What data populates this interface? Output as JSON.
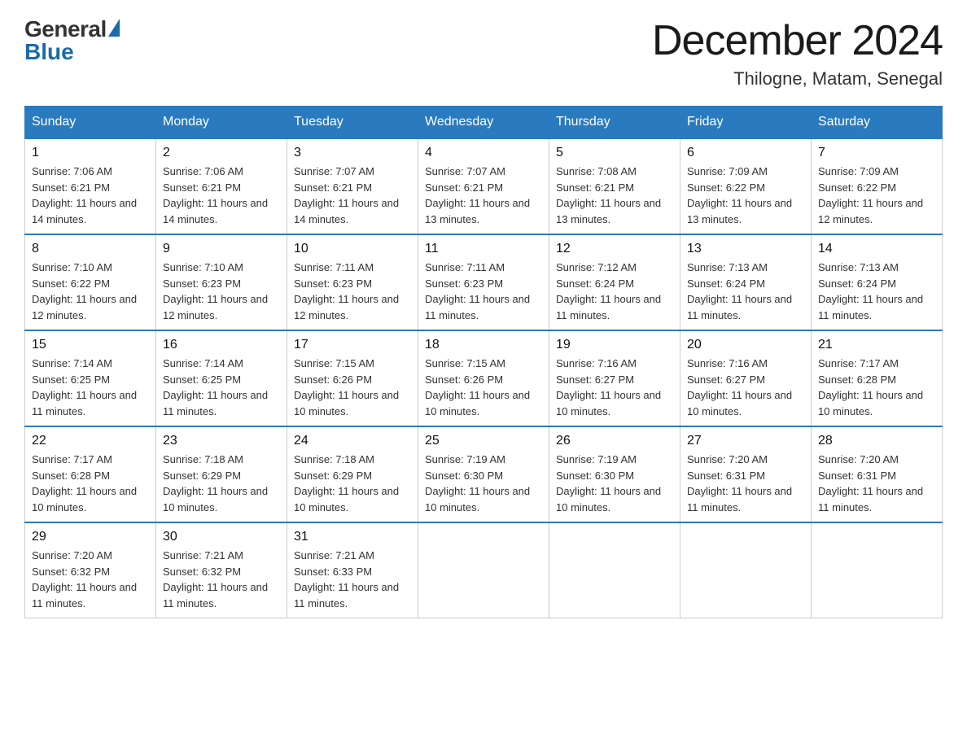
{
  "logo": {
    "general": "General",
    "blue": "Blue"
  },
  "title": "December 2024",
  "location": "Thilogne, Matam, Senegal",
  "days_of_week": [
    "Sunday",
    "Monday",
    "Tuesday",
    "Wednesday",
    "Thursday",
    "Friday",
    "Saturday"
  ],
  "weeks": [
    [
      {
        "day": "1",
        "sunrise": "7:06 AM",
        "sunset": "6:21 PM",
        "daylight": "11 hours and 14 minutes."
      },
      {
        "day": "2",
        "sunrise": "7:06 AM",
        "sunset": "6:21 PM",
        "daylight": "11 hours and 14 minutes."
      },
      {
        "day": "3",
        "sunrise": "7:07 AM",
        "sunset": "6:21 PM",
        "daylight": "11 hours and 14 minutes."
      },
      {
        "day": "4",
        "sunrise": "7:07 AM",
        "sunset": "6:21 PM",
        "daylight": "11 hours and 13 minutes."
      },
      {
        "day": "5",
        "sunrise": "7:08 AM",
        "sunset": "6:21 PM",
        "daylight": "11 hours and 13 minutes."
      },
      {
        "day": "6",
        "sunrise": "7:09 AM",
        "sunset": "6:22 PM",
        "daylight": "11 hours and 13 minutes."
      },
      {
        "day": "7",
        "sunrise": "7:09 AM",
        "sunset": "6:22 PM",
        "daylight": "11 hours and 12 minutes."
      }
    ],
    [
      {
        "day": "8",
        "sunrise": "7:10 AM",
        "sunset": "6:22 PM",
        "daylight": "11 hours and 12 minutes."
      },
      {
        "day": "9",
        "sunrise": "7:10 AM",
        "sunset": "6:23 PM",
        "daylight": "11 hours and 12 minutes."
      },
      {
        "day": "10",
        "sunrise": "7:11 AM",
        "sunset": "6:23 PM",
        "daylight": "11 hours and 12 minutes."
      },
      {
        "day": "11",
        "sunrise": "7:11 AM",
        "sunset": "6:23 PM",
        "daylight": "11 hours and 11 minutes."
      },
      {
        "day": "12",
        "sunrise": "7:12 AM",
        "sunset": "6:24 PM",
        "daylight": "11 hours and 11 minutes."
      },
      {
        "day": "13",
        "sunrise": "7:13 AM",
        "sunset": "6:24 PM",
        "daylight": "11 hours and 11 minutes."
      },
      {
        "day": "14",
        "sunrise": "7:13 AM",
        "sunset": "6:24 PM",
        "daylight": "11 hours and 11 minutes."
      }
    ],
    [
      {
        "day": "15",
        "sunrise": "7:14 AM",
        "sunset": "6:25 PM",
        "daylight": "11 hours and 11 minutes."
      },
      {
        "day": "16",
        "sunrise": "7:14 AM",
        "sunset": "6:25 PM",
        "daylight": "11 hours and 11 minutes."
      },
      {
        "day": "17",
        "sunrise": "7:15 AM",
        "sunset": "6:26 PM",
        "daylight": "11 hours and 10 minutes."
      },
      {
        "day": "18",
        "sunrise": "7:15 AM",
        "sunset": "6:26 PM",
        "daylight": "11 hours and 10 minutes."
      },
      {
        "day": "19",
        "sunrise": "7:16 AM",
        "sunset": "6:27 PM",
        "daylight": "11 hours and 10 minutes."
      },
      {
        "day": "20",
        "sunrise": "7:16 AM",
        "sunset": "6:27 PM",
        "daylight": "11 hours and 10 minutes."
      },
      {
        "day": "21",
        "sunrise": "7:17 AM",
        "sunset": "6:28 PM",
        "daylight": "11 hours and 10 minutes."
      }
    ],
    [
      {
        "day": "22",
        "sunrise": "7:17 AM",
        "sunset": "6:28 PM",
        "daylight": "11 hours and 10 minutes."
      },
      {
        "day": "23",
        "sunrise": "7:18 AM",
        "sunset": "6:29 PM",
        "daylight": "11 hours and 10 minutes."
      },
      {
        "day": "24",
        "sunrise": "7:18 AM",
        "sunset": "6:29 PM",
        "daylight": "11 hours and 10 minutes."
      },
      {
        "day": "25",
        "sunrise": "7:19 AM",
        "sunset": "6:30 PM",
        "daylight": "11 hours and 10 minutes."
      },
      {
        "day": "26",
        "sunrise": "7:19 AM",
        "sunset": "6:30 PM",
        "daylight": "11 hours and 10 minutes."
      },
      {
        "day": "27",
        "sunrise": "7:20 AM",
        "sunset": "6:31 PM",
        "daylight": "11 hours and 11 minutes."
      },
      {
        "day": "28",
        "sunrise": "7:20 AM",
        "sunset": "6:31 PM",
        "daylight": "11 hours and 11 minutes."
      }
    ],
    [
      {
        "day": "29",
        "sunrise": "7:20 AM",
        "sunset": "6:32 PM",
        "daylight": "11 hours and 11 minutes."
      },
      {
        "day": "30",
        "sunrise": "7:21 AM",
        "sunset": "6:32 PM",
        "daylight": "11 hours and 11 minutes."
      },
      {
        "day": "31",
        "sunrise": "7:21 AM",
        "sunset": "6:33 PM",
        "daylight": "11 hours and 11 minutes."
      },
      null,
      null,
      null,
      null
    ]
  ]
}
